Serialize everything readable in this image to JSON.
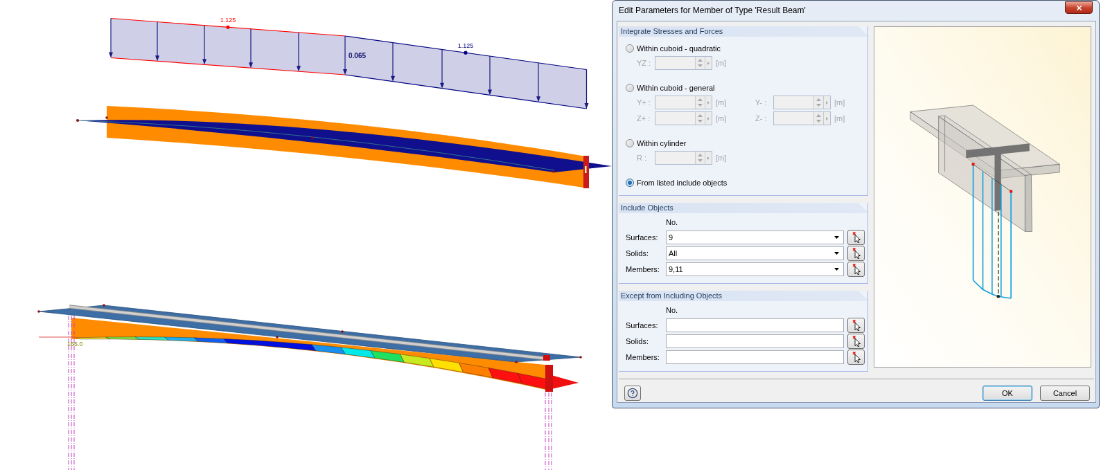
{
  "viewport": {
    "load_diagram": {
      "segments": [
        {
          "label": "1.125",
          "color": "#ff0000"
        },
        {
          "label": "1.125",
          "color": "#000080"
        }
      ],
      "value_label": "0.065"
    },
    "stress_label": "155.0"
  },
  "dialog": {
    "title": "Edit Parameters for Member of Type 'Result Beam'",
    "integrate": {
      "title": "Integrate Stresses and Forces",
      "options": [
        {
          "label": "Within cuboid - quadratic",
          "selected": false,
          "fields": [
            {
              "label": "YZ :",
              "unit": "[m]",
              "disabled": true
            }
          ]
        },
        {
          "label": "Within cuboid - general",
          "selected": false,
          "fields": [
            {
              "label": "Y+ :",
              "unit": "[m]",
              "disabled": true
            },
            {
              "label": "Y- :",
              "unit": "[m]",
              "disabled": true
            },
            {
              "label": "Z+ :",
              "unit": "[m]",
              "disabled": true
            },
            {
              "label": "Z- :",
              "unit": "[m]",
              "disabled": true
            }
          ]
        },
        {
          "label": "Within cylinder",
          "selected": false,
          "fields": [
            {
              "label": "R :",
              "unit": "[m]",
              "disabled": true
            }
          ]
        },
        {
          "label": "From listed include objects",
          "selected": true
        }
      ]
    },
    "include": {
      "title": "Include Objects",
      "column": "No.",
      "rows": [
        {
          "label": "Surfaces:",
          "kind": "dropdown",
          "value": "9"
        },
        {
          "label": "Solids:",
          "kind": "dropdown",
          "value": "All"
        },
        {
          "label": "Members:",
          "kind": "dropdown",
          "value": "9,11"
        }
      ]
    },
    "exclude": {
      "title": "Except from Including Objects",
      "column": "No.",
      "rows": [
        {
          "label": "Surfaces:",
          "kind": "text"
        },
        {
          "label": "Solids:",
          "kind": "text"
        },
        {
          "label": "Members:",
          "kind": "text"
        }
      ]
    },
    "buttons": [
      {
        "label": "OK",
        "default": true
      },
      {
        "label": "Cancel",
        "default": false
      }
    ]
  }
}
